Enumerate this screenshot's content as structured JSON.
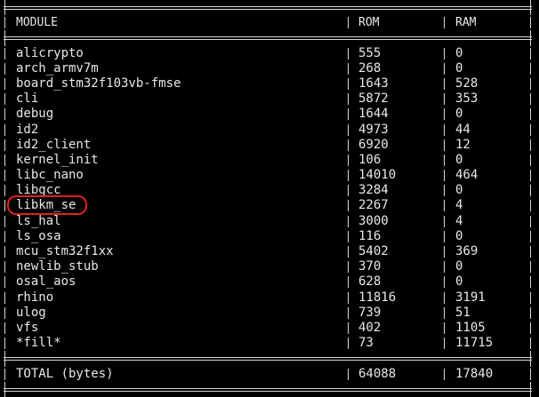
{
  "table": {
    "headers": {
      "module": "MODULE",
      "rom": "ROM",
      "ram": "RAM"
    },
    "rows": [
      {
        "module": "alicrypto",
        "rom": "555",
        "ram": "0"
      },
      {
        "module": "arch_armv7m",
        "rom": "268",
        "ram": "0"
      },
      {
        "module": "board_stm32f103vb-fmse",
        "rom": "1643",
        "ram": "528"
      },
      {
        "module": "cli",
        "rom": "5872",
        "ram": "353"
      },
      {
        "module": "debug",
        "rom": "1644",
        "ram": "0"
      },
      {
        "module": "id2",
        "rom": "4973",
        "ram": "44"
      },
      {
        "module": "id2_client",
        "rom": "6920",
        "ram": "12"
      },
      {
        "module": "kernel_init",
        "rom": "106",
        "ram": "0"
      },
      {
        "module": "libc_nano",
        "rom": "14010",
        "ram": "464"
      },
      {
        "module": "libgcc",
        "rom": "3284",
        "ram": "0"
      },
      {
        "module": "libkm_se",
        "rom": "2267",
        "ram": "4"
      },
      {
        "module": "ls_hal",
        "rom": "3000",
        "ram": "4"
      },
      {
        "module": "ls_osa",
        "rom": "116",
        "ram": "0"
      },
      {
        "module": "mcu_stm32f1xx",
        "rom": "5402",
        "ram": "369"
      },
      {
        "module": "newlib_stub",
        "rom": "370",
        "ram": "0"
      },
      {
        "module": "osal_aos",
        "rom": "628",
        "ram": "0"
      },
      {
        "module": "rhino",
        "rom": "11816",
        "ram": "3191"
      },
      {
        "module": "ulog",
        "rom": "739",
        "ram": "51"
      },
      {
        "module": "vfs",
        "rom": "402",
        "ram": "1105"
      },
      {
        "module": "*fill*",
        "rom": "73",
        "ram": "11715"
      }
    ],
    "total": {
      "module": "TOTAL (bytes)",
      "rom": "64088",
      "ram": "17840"
    }
  },
  "highlighted_module": "libkm_se",
  "colors": {
    "background": "#000000",
    "text": "#e8e8e8",
    "highlight": "#e0201c"
  }
}
